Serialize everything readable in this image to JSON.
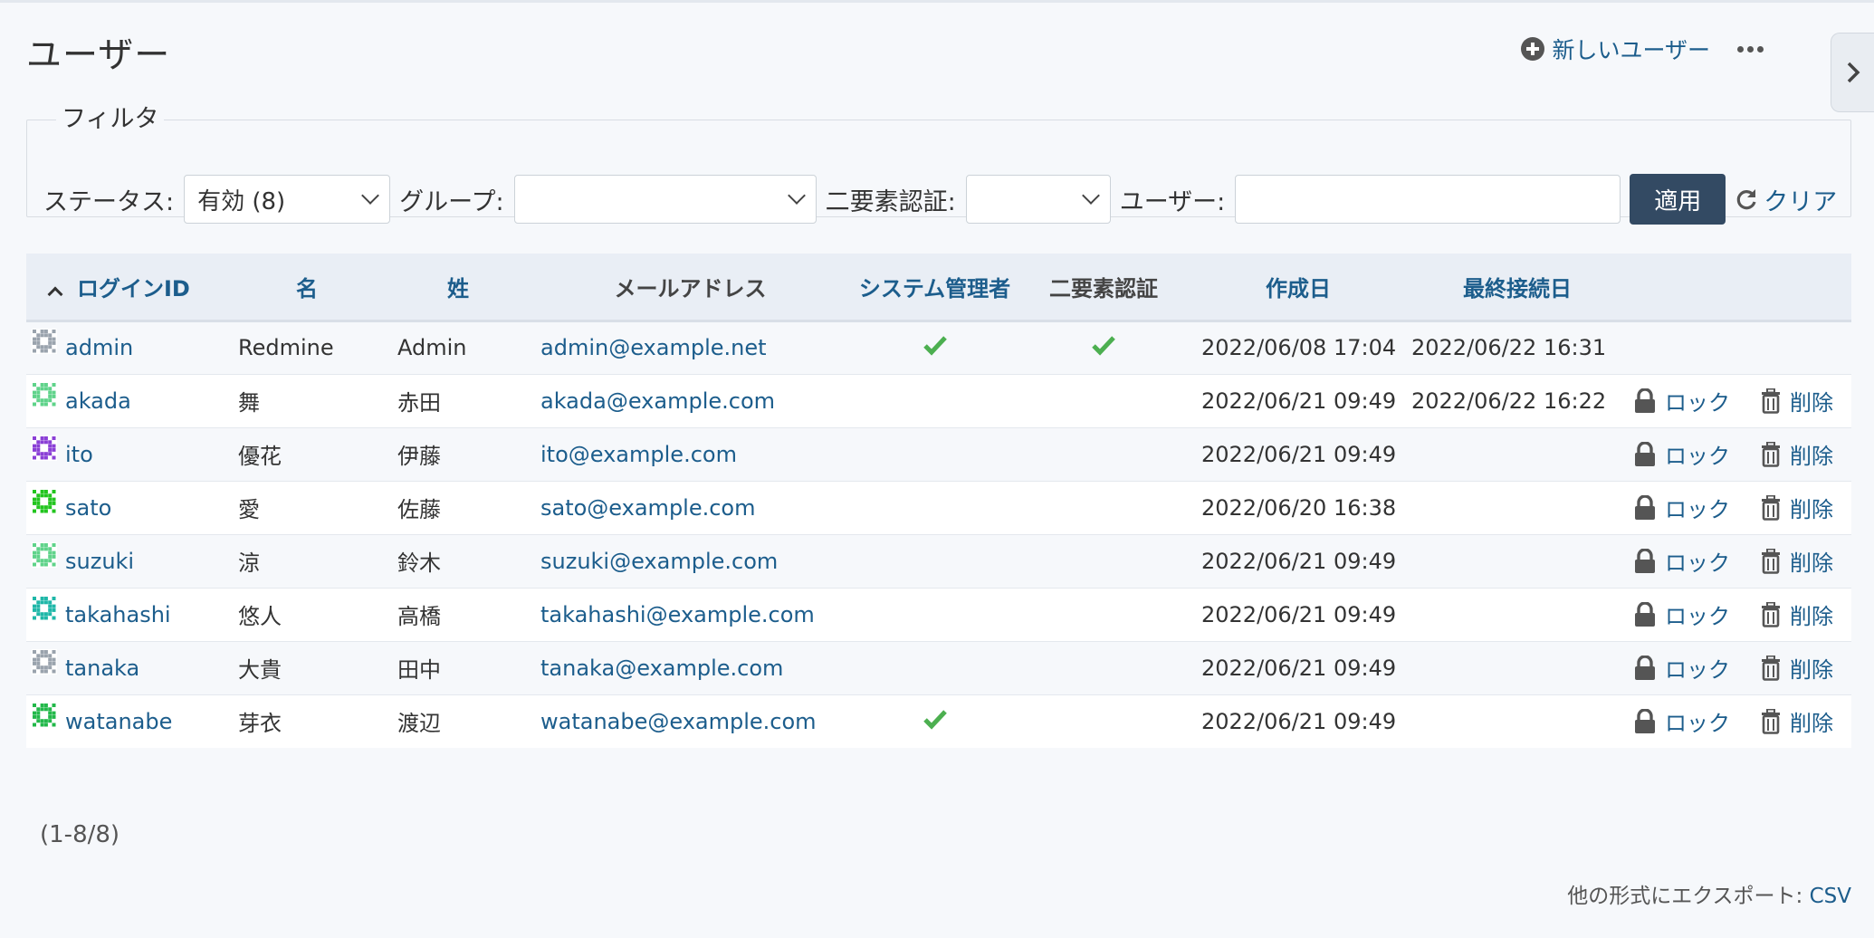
{
  "page": {
    "title": "ユーザー"
  },
  "contextual": {
    "new_user_label": "新しいユーザー"
  },
  "filters": {
    "legend": "フィルタ",
    "status_label": "ステータス:",
    "status_value": "有効 (8)",
    "group_label": "グループ:",
    "group_value": "",
    "twofa_label": "二要素認証:",
    "twofa_value": "",
    "user_label": "ユーザー:",
    "user_value": "",
    "apply_label": "適用",
    "clear_label": "クリア"
  },
  "table": {
    "headers": {
      "login": "ログインID",
      "firstname": "名",
      "lastname": "姓",
      "mail": "メールアドレス",
      "admin": "システム管理者",
      "twofa": "二要素認証",
      "created": "作成日",
      "last_login": "最終接続日"
    },
    "lock_label": "ロック",
    "delete_label": "削除",
    "rows": [
      {
        "login": "admin",
        "firstname": "Redmine",
        "lastname": "Admin",
        "mail": "admin@example.net",
        "admin": true,
        "twofa": true,
        "created": "2022/06/08 17:04",
        "last_login": "2022/06/22 16:31",
        "actions": false,
        "avatar_color": "#9aa3ad"
      },
      {
        "login": "akada",
        "firstname": "舞",
        "lastname": "赤田",
        "mail": "akada@example.com",
        "admin": false,
        "twofa": false,
        "created": "2022/06/21 09:49",
        "last_login": "2022/06/22 16:22",
        "actions": true,
        "avatar_color": "#5fd38a"
      },
      {
        "login": "ito",
        "firstname": "優花",
        "lastname": "伊藤",
        "mail": "ito@example.com",
        "admin": false,
        "twofa": false,
        "created": "2022/06/21 09:49",
        "last_login": "",
        "actions": true,
        "avatar_color": "#8a3fd6"
      },
      {
        "login": "sato",
        "firstname": "愛",
        "lastname": "佐藤",
        "mail": "sato@example.com",
        "admin": false,
        "twofa": false,
        "created": "2022/06/20 16:38",
        "last_login": "",
        "actions": true,
        "avatar_color": "#22c51e"
      },
      {
        "login": "suzuki",
        "firstname": "涼",
        "lastname": "鈴木",
        "mail": "suzuki@example.com",
        "admin": false,
        "twofa": false,
        "created": "2022/06/21 09:49",
        "last_login": "",
        "actions": true,
        "avatar_color": "#5fd38a"
      },
      {
        "login": "takahashi",
        "firstname": "悠人",
        "lastname": "高橋",
        "mail": "takahashi@example.com",
        "admin": false,
        "twofa": false,
        "created": "2022/06/21 09:49",
        "last_login": "",
        "actions": true,
        "avatar_color": "#1fb7a8"
      },
      {
        "login": "tanaka",
        "firstname": "大貴",
        "lastname": "田中",
        "mail": "tanaka@example.com",
        "admin": false,
        "twofa": false,
        "created": "2022/06/21 09:49",
        "last_login": "",
        "actions": true,
        "avatar_color": "#9aa3ad"
      },
      {
        "login": "watanabe",
        "firstname": "芽衣",
        "lastname": "渡辺",
        "mail": "watanabe@example.com",
        "admin": true,
        "twofa": false,
        "created": "2022/06/21 09:49",
        "last_login": "",
        "actions": true,
        "avatar_color": "#22b84a"
      }
    ]
  },
  "pagination": "(1-8/8)",
  "export": {
    "label": "他の形式にエクスポート:",
    "csv": "CSV"
  },
  "colors": {
    "link": "#1c5d8c",
    "check": "#4caf50",
    "apply_bg": "#334a63"
  }
}
